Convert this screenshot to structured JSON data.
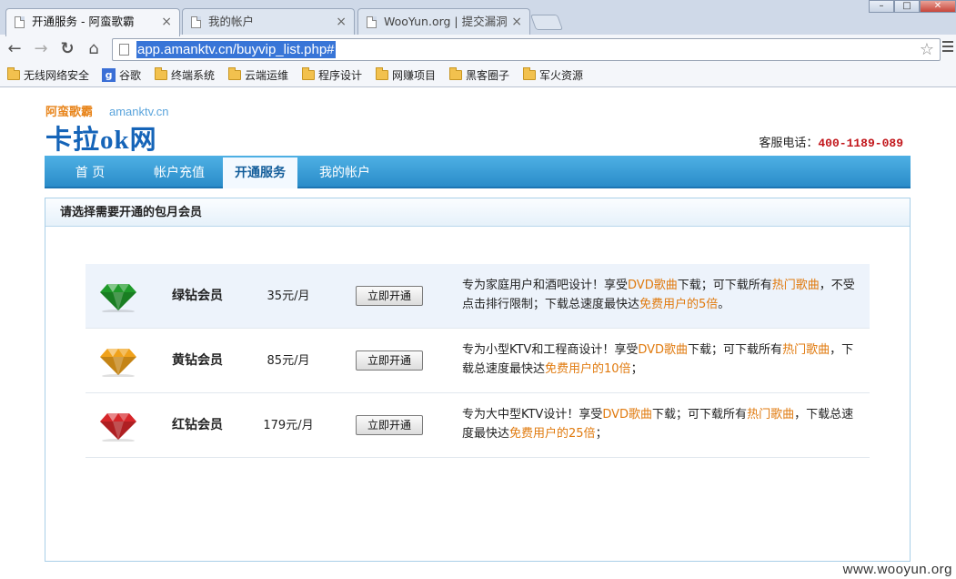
{
  "browser": {
    "tabs": [
      {
        "title": "开通服务 - 阿蛮歌霸",
        "close": "×"
      },
      {
        "title": "我的帐户",
        "close": "×"
      },
      {
        "title": "WooYun.org | 提交漏洞",
        "close": "×"
      }
    ],
    "window_buttons": {
      "minimize": "–",
      "maximize": "□",
      "close": "✕"
    },
    "url": "app.amanktv.cn/buyvip_list.php#",
    "nav": {
      "back": "←",
      "forward": "→",
      "reload": "↻",
      "home": "⌂",
      "star": "☆"
    },
    "bookmarks": [
      "无线网络安全",
      "谷歌",
      "终端系统",
      "云端运维",
      "程序设计",
      "网赚项目",
      "黑客圈子",
      "军火资源"
    ],
    "google_glyph": "g"
  },
  "site": {
    "logo_top": "阿蛮歌霸",
    "logo_domain": "amanktv.cn",
    "logo_main": "卡拉ok网",
    "hotline_label": "客服电话：",
    "hotline_number": "400-1189-089"
  },
  "mainnav": {
    "items": [
      "首 页",
      "帐户充值",
      "开通服务",
      "我的帐户"
    ],
    "active": "开通服务"
  },
  "panel": {
    "title": "请选择需要开通的包月会员",
    "plans": [
      {
        "name": "绿钻会员",
        "price": "35元/月",
        "button": "立即开通",
        "gem_color": "#1f9a2a",
        "desc": [
          {
            "t": "专为家庭用户和酒吧设计！享受"
          },
          {
            "t": "DVD歌曲",
            "hl": true
          },
          {
            "t": "下载；可下载所有"
          },
          {
            "t": "热门歌曲",
            "hl": true
          },
          {
            "t": "，不受点击排行限制；下载总速度最快达"
          },
          {
            "t": "免费用户的5倍",
            "hl": true
          },
          {
            "t": "。"
          }
        ]
      },
      {
        "name": "黄钻会员",
        "price": "85元/月",
        "button": "立即开通",
        "gem_color": "#f0a21c",
        "desc": [
          {
            "t": "专为小型KTV和工程商设计！享受"
          },
          {
            "t": "DVD歌曲",
            "hl": true
          },
          {
            "t": "下载；可下载所有"
          },
          {
            "t": "热门歌曲",
            "hl": true
          },
          {
            "t": "，下载总速度最快达"
          },
          {
            "t": "免费用户的10倍",
            "hl": true
          },
          {
            "t": "；"
          }
        ]
      },
      {
        "name": "红钻会员",
        "price": "179元/月",
        "button": "立即开通",
        "gem_color": "#d6262a",
        "desc": [
          {
            "t": "专为大中型KTV设计！享受"
          },
          {
            "t": "DVD歌曲",
            "hl": true
          },
          {
            "t": "下载；可下载所有"
          },
          {
            "t": "热门歌曲",
            "hl": true
          },
          {
            "t": "，下载总速度最快达"
          },
          {
            "t": "免费用户的25倍",
            "hl": true
          },
          {
            "t": "；"
          }
        ]
      }
    ]
  },
  "watermark": "www.wooyun.org",
  "colors": {
    "nav_blue": "#2a8cc9",
    "highlight": "#e07a0e",
    "hotline": "#c2161b",
    "logo_blue": "#1564b8"
  }
}
